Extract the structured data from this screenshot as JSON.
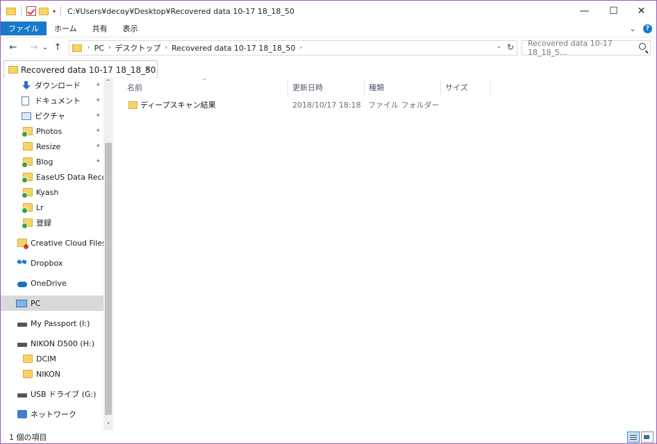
{
  "window": {
    "title": "C:¥Users¥decoy¥Desktop¥Recovered data 10-17 18_18_50",
    "controls": {
      "minimize": "—",
      "maximize": "☐",
      "close": "✕"
    }
  },
  "ribbon": {
    "tabs": [
      "ファイル",
      "ホーム",
      "共有",
      "表示"
    ],
    "expand_glyph": "⌄",
    "help_glyph": "?"
  },
  "address": {
    "back": "←",
    "forward": "→",
    "recent": "⌄",
    "up": "↑",
    "breadcrumbs": [
      "PC",
      "デスクトップ",
      "Recovered data 10-17 18_18_50"
    ],
    "separator": "›",
    "dropdown": "⌄",
    "refresh": "↻"
  },
  "search": {
    "placeholder": "Recovered data 10-17 18_18_5..."
  },
  "tab": {
    "label": "Recovered data 10-17 18_18_50",
    "close": "✕"
  },
  "sidebar": {
    "pin_glyph": "✦",
    "items": [
      {
        "label": "ダウンロード",
        "icon": "download-icon",
        "pinned": true
      },
      {
        "label": "ドキュメント",
        "icon": "document-icon",
        "pinned": true
      },
      {
        "label": "ピクチャ",
        "icon": "pictures-icon",
        "pinned": true
      },
      {
        "label": "Photos",
        "icon": "folder-sync-icon",
        "pinned": true
      },
      {
        "label": "Resize",
        "icon": "folder-icon",
        "pinned": true
      },
      {
        "label": "Blog",
        "icon": "folder-sync-icon",
        "pinned": true
      },
      {
        "label": "EaseUS Data Recover",
        "icon": "folder-sync-icon",
        "pinned": false
      },
      {
        "label": "Kyash",
        "icon": "folder-sync-icon",
        "pinned": false
      },
      {
        "label": "Lr",
        "icon": "folder-sync-icon",
        "pinned": false
      },
      {
        "label": "登録",
        "icon": "folder-sync-icon",
        "pinned": false
      },
      {
        "label": "Creative Cloud Files",
        "icon": "creative-cloud-icon",
        "pinned": false
      },
      {
        "label": "Dropbox",
        "icon": "dropbox-icon",
        "pinned": false
      },
      {
        "label": "OneDrive",
        "icon": "onedrive-icon",
        "pinned": false
      },
      {
        "label": "PC",
        "icon": "pc-icon",
        "pinned": false,
        "selected": true
      },
      {
        "label": "My Passport (I:)",
        "icon": "drive-icon",
        "pinned": false
      },
      {
        "label": "NIKON D500 (H:)",
        "icon": "drive-icon",
        "pinned": false
      },
      {
        "label": "DCIM",
        "icon": "folder-icon",
        "pinned": false
      },
      {
        "label": "NIKON",
        "icon": "folder-icon",
        "pinned": false
      },
      {
        "label": "USB ドライブ (G:)",
        "icon": "drive-icon",
        "pinned": false
      },
      {
        "label": "ネットワーク",
        "icon": "network-icon",
        "pinned": false
      }
    ]
  },
  "scrollbar": {
    "up": "⌃",
    "down": "⌄"
  },
  "columns": {
    "sort_glyph": "^",
    "headers": [
      "名前",
      "更新日時",
      "種類",
      "サイズ"
    ]
  },
  "files": [
    {
      "name": "ディープスキャン結果",
      "modified": "2018/10/17 18:18",
      "type": "ファイル フォルダー",
      "size": ""
    }
  ],
  "status": {
    "text": "1 個の項目"
  }
}
